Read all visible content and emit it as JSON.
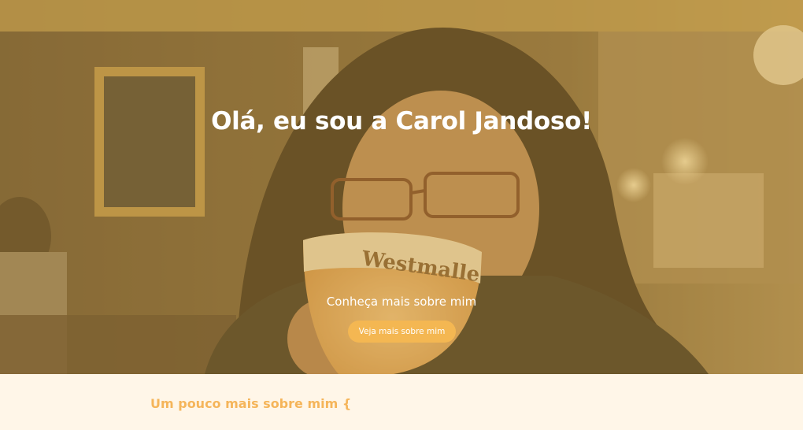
{
  "hero": {
    "title": "Olá, eu sou a Carol Jandoso!",
    "subtitle": "Conheça mais sobre mim",
    "button_label": "Veja mais sobre mim",
    "glass_text": "Westmalle"
  },
  "about": {
    "title": "Um pouco mais sobre mim {"
  },
  "colors": {
    "accent": "#f4b752",
    "overlay": "#c4963c",
    "background": "#fff6e8",
    "section_title": "#f5b55a"
  }
}
